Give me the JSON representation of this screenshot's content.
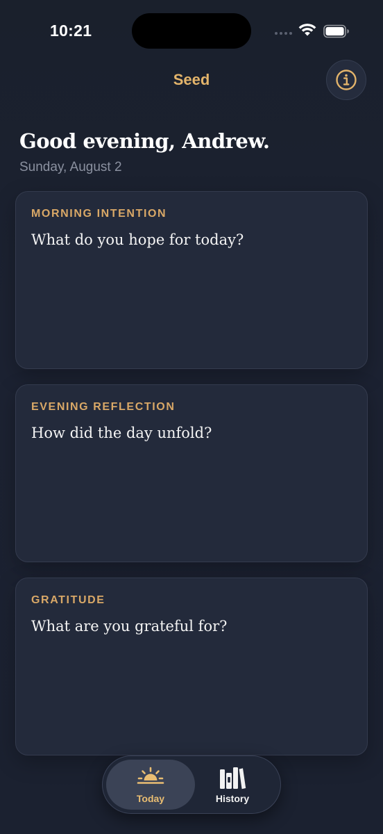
{
  "status_bar": {
    "time": "10:21"
  },
  "header": {
    "title": "Seed",
    "info_icon": "info-circle-icon"
  },
  "greeting": {
    "text": "Good evening, Andrew.",
    "date": "Sunday, August 2"
  },
  "cards": [
    {
      "label": "MORNING INTENTION",
      "prompt": "What do you hope for today?"
    },
    {
      "label": "EVENING REFLECTION",
      "prompt": "How did the day unfold?"
    },
    {
      "label": "GRATITUDE",
      "prompt": "What are you grateful for?"
    }
  ],
  "tab_bar": {
    "tabs": [
      {
        "label": "Today",
        "icon": "sunrise-icon",
        "selected": true
      },
      {
        "label": "History",
        "icon": "books-icon",
        "selected": false
      }
    ]
  },
  "colors": {
    "accent": "#e3b46b",
    "background": "#1b2130",
    "card": "#232a3b"
  }
}
